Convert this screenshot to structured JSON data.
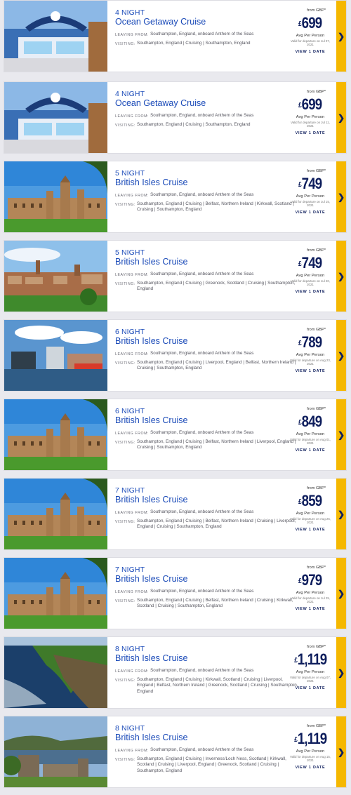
{
  "cruises": [
    {
      "nights": "4 NIGHT",
      "title": "Ocean Getaway Cruise",
      "leaving_label": "LEAVING FROM:",
      "leaving": "Southampton, England, onboard Anthem of the Seas",
      "visiting_label": "VISITING:",
      "visiting": "Southampton, England  |  Cruising  |  Southampton, England",
      "from": "from GBP*",
      "currency": "£",
      "price": "699",
      "per": "Avg Per Person",
      "valid": "Valid for departure on Jul 07, 2021",
      "view": "VIEW 1 DATE",
      "image": "ship-deck"
    },
    {
      "nights": "4 NIGHT",
      "title": "Ocean Getaway Cruise",
      "leaving_label": "LEAVING FROM:",
      "leaving": "Southampton, England, onboard Anthem of the Seas",
      "visiting_label": "VISITING:",
      "visiting": "Southampton, England  |  Cruising  |  Southampton, England",
      "from": "from GBP*",
      "currency": "£",
      "price": "699",
      "per": "Avg Per Person",
      "valid": "Valid for departure on Jul 11, 2021",
      "view": "VIEW 1 DATE",
      "image": "ship-deck"
    },
    {
      "nights": "5 NIGHT",
      "title": "British Isles Cruise",
      "leaving_label": "LEAVING FROM:",
      "leaving": "Southampton, England, onboard Anthem of the Seas",
      "visiting_label": "VISITING:",
      "visiting": "Southampton, England  |  Cruising  |  Belfast, Northern Ireland  |  Kirkwall, Scotland  |  Cruising  |  Southampton, England",
      "from": "from GBP*",
      "currency": "£",
      "price": "749",
      "per": "Avg Per Person",
      "valid": "Valid for departure on Jul 15, 2021",
      "view": "VIEW 1 DATE",
      "image": "castle"
    },
    {
      "nights": "5 NIGHT",
      "title": "British Isles Cruise",
      "leaving_label": "LEAVING FROM:",
      "leaving": "Southampton, England, onboard Anthem of the Seas",
      "visiting_label": "VISITING:",
      "visiting": "Southampton, England  |  Cruising  |  Greenock, Scotland  |  Cruising  |  Southampton, England",
      "from": "from GBP*",
      "currency": "£",
      "price": "749",
      "per": "Avg Per Person",
      "valid": "Valid for departure on Jul 20, 2021",
      "view": "VIEW 1 DATE",
      "image": "city"
    },
    {
      "nights": "6 NIGHT",
      "title": "British Isles Cruise",
      "leaving_label": "LEAVING FROM:",
      "leaving": "Southampton, England, onboard Anthem of the Seas",
      "visiting_label": "VISITING:",
      "visiting": "Southampton, England  |  Cruising  |  Liverpool, England  |  Belfast, Northern Ireland  |  Cruising  |  Southampton, England",
      "from": "from GBP*",
      "currency": "£",
      "price": "789",
      "per": "Avg Per Person",
      "valid": "Valid for departure on Aug 23, 2021",
      "view": "VIEW 1 DATE",
      "image": "harbor"
    },
    {
      "nights": "6 NIGHT",
      "title": "British Isles Cruise",
      "leaving_label": "LEAVING FROM:",
      "leaving": "Southampton, England, onboard Anthem of the Seas",
      "visiting_label": "VISITING:",
      "visiting": "Southampton, England  |  Cruising  |  Belfast, Northern Ireland  |  Liverpool, England  |  Cruising  |  Southampton, England",
      "from": "from GBP*",
      "currency": "£",
      "price": "849",
      "per": "Avg Per Person",
      "valid": "Valid for departure on Aug 01, 2021",
      "view": "VIEW 1 DATE",
      "image": "castle"
    },
    {
      "nights": "7 NIGHT",
      "title": "British Isles Cruise",
      "leaving_label": "LEAVING FROM:",
      "leaving": "Southampton, England, onboard Anthem of the Seas",
      "visiting_label": "VISITING:",
      "visiting": "Southampton, England  |  Cruising  |  Belfast, Northern Ireland  |  Cruising  |  Liverpool, England  |  Cruising  |  Southampton, England",
      "from": "from GBP*",
      "currency": "£",
      "price": "859",
      "per": "Avg Per Person",
      "valid": "Valid for departure on Aug 26, 2021",
      "view": "VIEW 1 DATE",
      "image": "castle"
    },
    {
      "nights": "7 NIGHT",
      "title": "British Isles Cruise",
      "leaving_label": "LEAVING FROM:",
      "leaving": "Southampton, England, onboard Anthem of the Seas",
      "visiting_label": "VISITING:",
      "visiting": "Southampton, England  |  Cruising  |  Belfast, Northern Ireland  |  Cruising  |  Kirkwall, Scotland  |  Cruising  |  Southampton, England",
      "from": "from GBP*",
      "currency": "£",
      "price": "979",
      "per": "Avg Per Person",
      "valid": "Valid for departure on Jul 25, 2021",
      "view": "VIEW 1 DATE",
      "image": "castle"
    },
    {
      "nights": "8 NIGHT",
      "title": "British Isles Cruise",
      "leaving_label": "LEAVING FROM:",
      "leaving": "Southampton, England, onboard Anthem of the Seas",
      "visiting_label": "VISITING:",
      "visiting": "Southampton, England  |  Cruising  |  Kirkwall, Scotland  |  Cruising  |  Liverpool, England  |  Belfast, Northern Ireland  |  Greenock, Scotland  |  Cruising  |  Southampton, England",
      "from": "from GBP*",
      "currency": "£",
      "price": "1,119",
      "per": "Avg Per Person",
      "valid": "Valid for departure on Aug 07, 2021",
      "view": "VIEW 1 DATE",
      "image": "coast"
    },
    {
      "nights": "8 NIGHT",
      "title": "British Isles Cruise",
      "leaving_label": "LEAVING FROM:",
      "leaving": "Southampton, England, onboard Anthem of the Seas",
      "visiting_label": "VISITING:",
      "visiting": "Southampton, England  |  Cruising  |  Inverness/Loch Ness, Scotland  |  Kirkwall, Scotland  |  Cruising  |  Liverpool, England  |  Greenock, Scotland  |  Cruising  |  Southampton, England",
      "from": "from GBP*",
      "currency": "£",
      "price": "1,119",
      "per": "Avg Per Person",
      "valid": "Valid for departure on Aug 15, 2021",
      "view": "VIEW 1 DATE",
      "image": "loch-ruins"
    }
  ],
  "arrow_icon": "chevron-right-icon",
  "colors": {
    "title": "#1a4ab8",
    "price": "#0d1d5c",
    "accent": "#f5b800"
  }
}
